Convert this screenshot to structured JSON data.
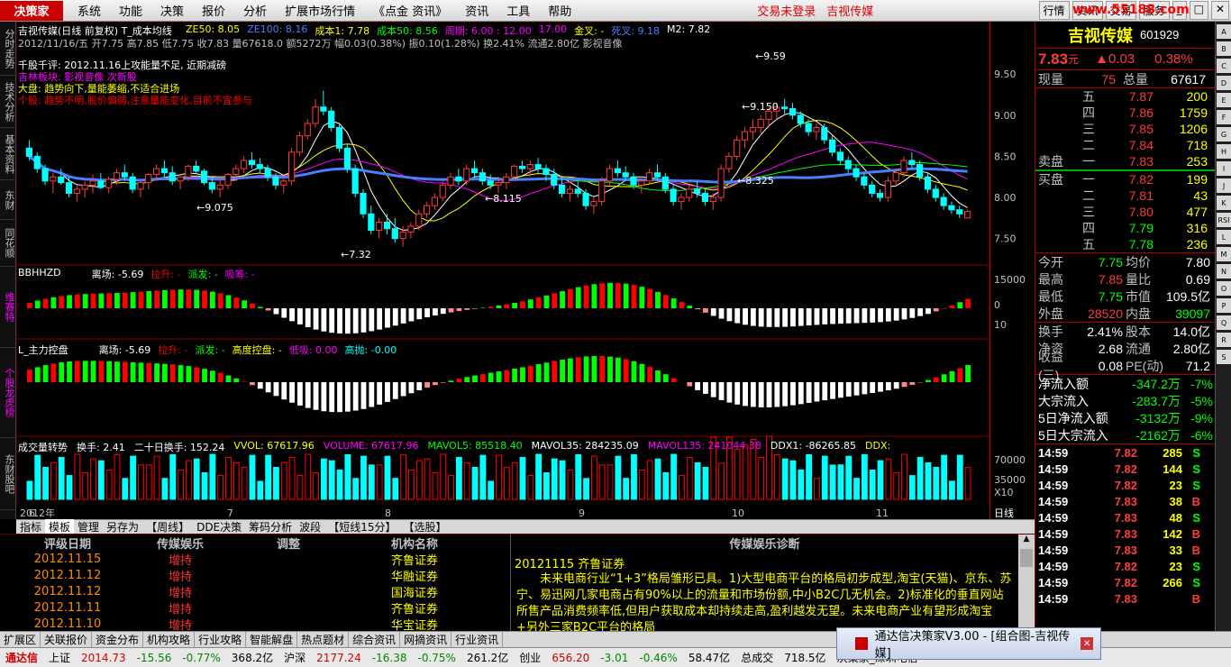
{
  "menubar": {
    "logo": "决策家",
    "items": [
      "系统",
      "功能",
      "决策",
      "报价",
      "分析",
      "扩展市场行情",
      "《点金 资讯》",
      "资讯",
      "工具",
      "帮助"
    ],
    "alerts": [
      "交易未登录",
      "吉视传媒"
    ],
    "right_buttons": [
      "行情",
      "资讯",
      "交易",
      "服务"
    ],
    "watermark": "www.55188.com"
  },
  "left_tabs": [
    "分时走势",
    "技术分析",
    "基本资料",
    "东财",
    "同花顺"
  ],
  "price_panel": {
    "title": "吉视传媒(日线 前复权) T_成本均线",
    "ma_labels": [
      {
        "t": "ZE50: 8.05",
        "c": "#ff0"
      },
      {
        "t": "ZE100: 8.16",
        "c": "#4a80ff"
      },
      {
        "t": "成本1: 7.78",
        "c": "#ff0"
      },
      {
        "t": "成本50: 8.56",
        "c": "#0f0"
      },
      {
        "t": "周期: 6.00 : 12.00",
        "c": "#f0f"
      },
      {
        "t": "17.00",
        "c": "#f0f"
      },
      {
        "t": "金叉: -",
        "c": "#ff0"
      },
      {
        "t": "死叉: 9.18",
        "c": "#4a80ff"
      },
      {
        "t": "M2: 7.82",
        "c": "#fff"
      }
    ],
    "info_line": "2012/11/16/五 开7.75 高7.85 低7.75 收7.83 量67618.0 额5272万 幅0.03(0.38%) 振0.10(1.28%) 换2.41% 流通2.80亿 影视音像",
    "comments": [
      {
        "t": "千股千评: 2012.11.16上攻能量不足, 近期减磅",
        "c": "#fff"
      },
      {
        "t": "吉林板块: 影视音像 次新股",
        "c": "#f0f"
      },
      {
        "t": "大盘: 趋势向下,量能萎缩,不适合进场",
        "c": "#ff0"
      },
      {
        "t": "个股: 趋势不明,股价偏弱,注意量能变化,目前不宜参与",
        "c": "#f00"
      }
    ],
    "annotations": [
      "9.075",
      "8.115",
      "8.325",
      "9.150",
      "9.59",
      "7.32"
    ],
    "y_ticks": [
      "9.50",
      "9.00",
      "8.50",
      "8.00",
      "7.50"
    ]
  },
  "ind1": {
    "name": "BBHHZD",
    "labels": [
      {
        "t": "离场: -5.69",
        "c": "#fff"
      },
      {
        "t": "拉升: -",
        "c": "#f00"
      },
      {
        "t": "派发: -",
        "c": "#0f0"
      },
      {
        "t": "吸筹: -",
        "c": "#f0f"
      }
    ],
    "y_ticks": [
      "15000",
      "0",
      "10"
    ],
    "side": "维赛特"
  },
  "ind2": {
    "name": "L_主力控盘",
    "labels": [
      {
        "t": "离场: -5.69",
        "c": "#fff"
      },
      {
        "t": "拉升: -",
        "c": "#f00"
      },
      {
        "t": "派发: -",
        "c": "#0f0"
      },
      {
        "t": "高度控盘: -",
        "c": "#ff0"
      },
      {
        "t": "低吸: 0.00",
        "c": "#f0f"
      },
      {
        "t": "高抛: -0.00",
        "c": "#0ff"
      }
    ],
    "side": "个股龙虎榜"
  },
  "ind3": {
    "name": "成交量转势",
    "labels": [
      {
        "t": "换手: 2.41",
        "c": "#fff"
      },
      {
        "t": "二十日换手: 152.24",
        "c": "#fff"
      },
      {
        "t": "VVOL: 67617.96",
        "c": "#ff0"
      },
      {
        "t": "VOLUME: 67617.96",
        "c": "#f0f"
      },
      {
        "t": "MAVOL5: 85518.40",
        "c": "#0f0"
      },
      {
        "t": "MAVOL35: 284235.09",
        "c": "#fff"
      },
      {
        "t": "MAVOL135: 241044.38",
        "c": "#f0f"
      },
      {
        "t": "DDX1: -86265.85",
        "c": "#fff"
      },
      {
        "t": "DDX:",
        "c": "#ff0"
      }
    ],
    "y_ticks": [
      "70000",
      "35000",
      "X10"
    ],
    "side": "东财股吧"
  },
  "date_axis": [
    "2012年",
    "6",
    "7",
    "8",
    "9",
    "10",
    "11"
  ],
  "date_axis_right": "日线",
  "bottom_tabs": [
    "指标",
    "模板",
    "管理",
    "另存为",
    "【周线】",
    "DDE决策",
    "筹码分析",
    "波段",
    "【短线15分】",
    "【选股】"
  ],
  "rating_table": {
    "headers": [
      "评级日期",
      "传媒娱乐",
      "调整",
      "机构名称"
    ],
    "rows": [
      [
        "2012.11.15",
        "增持",
        "",
        "齐鲁证券"
      ],
      [
        "2012.11.12",
        "增持",
        "",
        "华融证券"
      ],
      [
        "2012.11.12",
        "增持",
        "",
        "国海证券"
      ],
      [
        "2012.11.11",
        "增持",
        "",
        "齐鲁证券"
      ],
      [
        "2012.11.10",
        "增持",
        "",
        "华宝证券"
      ]
    ]
  },
  "diagnosis": {
    "title": "传媒娱乐诊断",
    "date_line": "20121115 齐鲁证券",
    "body": "未来电商行业“1+3”格局雏形已具。1)大型电商平台的格局初步成型,淘宝(天猫)、京东、苏宁、易迅网几家电商占有90%以上的流量和市场份额,中小B2C几无机会。2)标准化的垂直网站所售产品消费频率低,但用户获取成本却持续走高,盈利越发无望。未来电商产业有望形成淘宝+另外三家B2C平台的格局"
  },
  "quote": {
    "name": "吉视传媒",
    "code": "601929",
    "price": "7.83",
    "unit": "元",
    "change": "▲0.03",
    "pct": "0.38%",
    "now_vol_label": "现量",
    "now_vol": "75",
    "total_label": "总量",
    "total": "67617",
    "sells": [
      {
        "l": "五",
        "p": "7.87",
        "v": "200"
      },
      {
        "l": "四",
        "p": "7.86",
        "v": "1759"
      },
      {
        "l": "三",
        "p": "7.85",
        "v": "1206"
      },
      {
        "l": "二",
        "p": "7.84",
        "v": "718"
      },
      {
        "l": "一",
        "p": "7.83",
        "v": "253"
      }
    ],
    "sell_label": "卖盘",
    "buy_label": "买盘",
    "buys": [
      {
        "l": "一",
        "p": "7.82",
        "v": "199"
      },
      {
        "l": "二",
        "p": "7.81",
        "v": "43"
      },
      {
        "l": "三",
        "p": "7.80",
        "v": "477"
      },
      {
        "l": "四",
        "p": "7.79",
        "v": "316"
      },
      {
        "l": "五",
        "p": "7.78",
        "v": "236"
      }
    ],
    "stats": [
      [
        {
          "l": "今开",
          "v": "7.75",
          "c": "#0f0"
        },
        {
          "l": "均价",
          "v": "7.80",
          "c": "#fff"
        }
      ],
      [
        {
          "l": "最高",
          "v": "7.85",
          "c": "#ff3b3b"
        },
        {
          "l": "量比",
          "v": "0.69",
          "c": "#fff"
        }
      ],
      [
        {
          "l": "最低",
          "v": "7.75",
          "c": "#0f0"
        },
        {
          "l": "市值",
          "v": "109.5亿",
          "c": "#fff"
        }
      ],
      [
        {
          "l": "外盘",
          "v": "28520",
          "c": "#ff3b3b"
        },
        {
          "l": "内盘",
          "v": "39097",
          "c": "#0f0"
        }
      ]
    ],
    "stats2": [
      [
        {
          "l": "换手",
          "v": "2.41%",
          "c": "#fff"
        },
        {
          "l": "股本",
          "v": "14.0亿",
          "c": "#fff"
        }
      ],
      [
        {
          "l": "净资",
          "v": "2.68",
          "c": "#fff"
        },
        {
          "l": "流通",
          "v": "2.80亿",
          "c": "#fff"
        }
      ],
      [
        {
          "l": "收益(三)",
          "v": "0.08",
          "c": "#fff"
        },
        {
          "l": "PE(动)",
          "v": "71.2",
          "c": "#fff"
        }
      ]
    ],
    "flows": [
      {
        "l": "净流入额",
        "v": "-347.2万",
        "p": "-7%"
      },
      {
        "l": "大宗流入",
        "v": "-283.7万",
        "p": "-5%"
      },
      {
        "l": "5日净流入额",
        "v": "-3132万",
        "p": "-9%"
      },
      {
        "l": "5日大宗流入",
        "v": "-2162万",
        "p": "-6%"
      }
    ],
    "ticks": [
      [
        "14:59",
        "7.82",
        "285",
        "S"
      ],
      [
        "14:59",
        "7.82",
        "144",
        "S"
      ],
      [
        "14:59",
        "7.82",
        "23",
        "S"
      ],
      [
        "14:59",
        "7.83",
        "38",
        "B"
      ],
      [
        "14:59",
        "7.83",
        "48",
        "S"
      ],
      [
        "14:59",
        "7.83",
        "142",
        "B"
      ],
      [
        "14:59",
        "7.83",
        "33",
        "B"
      ],
      [
        "14:59",
        "7.82",
        "23",
        "S"
      ],
      [
        "14:59",
        "7.82",
        "266",
        "S"
      ],
      [
        "14:59",
        "7.83",
        "",
        "B"
      ]
    ]
  },
  "nav_tabs": [
    "扩展区",
    "关联报价",
    "资金分布",
    "机构攻略",
    "行业攻略",
    "智能解盘",
    "热点题材",
    "综合资讯",
    "网摘资讯",
    "行业资讯"
  ],
  "status": {
    "brand": "通达信",
    "items": [
      {
        "t": "上证",
        "c": "#000"
      },
      {
        "t": "2014.73",
        "c": "#c00"
      },
      {
        "t": "-15.56",
        "c": "#080"
      },
      {
        "t": "-0.77%",
        "c": "#080"
      },
      {
        "t": "368.2亿",
        "c": "#000"
      },
      {
        "t": "沪深",
        "c": "#000"
      },
      {
        "t": "2177.24",
        "c": "#c00"
      },
      {
        "t": "-16.38",
        "c": "#080"
      },
      {
        "t": "-0.75%",
        "c": "#080"
      },
      {
        "t": "261.2亿",
        "c": "#000"
      },
      {
        "t": "创业",
        "c": "#000"
      },
      {
        "t": "656.20",
        "c": "#c00"
      },
      {
        "t": "-3.01",
        "c": "#080"
      },
      {
        "t": "-0.46%",
        "c": "#080"
      },
      {
        "t": "58.47亿",
        "c": "#000"
      },
      {
        "t": "总成交",
        "c": "#000"
      },
      {
        "t": "718.5亿",
        "c": "#000"
      },
      {
        "t": "决策家_深圳电信",
        "c": "#000"
      }
    ]
  },
  "popup": {
    "text": "通达信决策家V3.00 - [组合图-吉视传媒]"
  },
  "right_tool_icons": [
    "A",
    "B",
    "C",
    "D",
    "E",
    "F",
    "G",
    "H",
    "I",
    "J",
    "K",
    "RSI",
    "L",
    "M",
    "N",
    "O",
    "P",
    "Q",
    "R",
    "S"
  ],
  "chart_data": {
    "type": "candlestick",
    "title": "吉视传媒(日线 前复权)",
    "ylim": [
      7.2,
      9.7
    ],
    "ohlc": [
      [
        8.6,
        8.7,
        8.45,
        8.5
      ],
      [
        8.5,
        8.55,
        8.3,
        8.35
      ],
      [
        8.35,
        8.4,
        8.15,
        8.2
      ],
      [
        8.2,
        8.3,
        8.05,
        8.25
      ],
      [
        8.25,
        8.35,
        8.15,
        8.18
      ],
      [
        8.18,
        8.25,
        8.0,
        8.05
      ],
      [
        8.05,
        8.15,
        7.95,
        8.1
      ],
      [
        8.1,
        8.2,
        8.0,
        8.15
      ],
      [
        8.15,
        8.28,
        8.05,
        8.2
      ],
      [
        8.2,
        8.3,
        8.1,
        8.12
      ],
      [
        8.12,
        8.25,
        8.05,
        8.22
      ],
      [
        8.22,
        8.35,
        8.15,
        8.3
      ],
      [
        8.3,
        8.4,
        8.2,
        8.25
      ],
      [
        8.25,
        8.3,
        8.05,
        8.1
      ],
      [
        8.1,
        8.2,
        8.0,
        8.18
      ],
      [
        8.18,
        8.3,
        8.1,
        8.28
      ],
      [
        8.28,
        8.4,
        8.2,
        8.35
      ],
      [
        8.35,
        8.45,
        8.25,
        8.3
      ],
      [
        8.3,
        8.38,
        8.15,
        8.2
      ],
      [
        8.2,
        8.28,
        8.1,
        8.25
      ],
      [
        8.25,
        8.4,
        8.2,
        8.38
      ],
      [
        8.38,
        8.45,
        8.3,
        8.32
      ],
      [
        8.32,
        8.35,
        8.15,
        8.18
      ],
      [
        8.18,
        8.25,
        8.05,
        8.1
      ],
      [
        8.1,
        8.2,
        8.0,
        8.15
      ],
      [
        8.15,
        8.3,
        8.1,
        8.28
      ],
      [
        8.28,
        8.4,
        8.2,
        8.35
      ],
      [
        8.35,
        8.5,
        8.3,
        8.45
      ],
      [
        8.45,
        8.55,
        8.35,
        8.4
      ],
      [
        8.4,
        8.48,
        8.3,
        8.35
      ],
      [
        8.35,
        8.4,
        8.2,
        8.25
      ],
      [
        8.25,
        8.3,
        8.1,
        8.15
      ],
      [
        8.15,
        8.25,
        8.05,
        8.2
      ],
      [
        8.2,
        8.6,
        8.15,
        8.55
      ],
      [
        8.55,
        8.8,
        8.5,
        8.75
      ],
      [
        8.75,
        8.95,
        8.7,
        8.9
      ],
      [
        8.9,
        9.2,
        8.85,
        9.1
      ],
      [
        9.1,
        9.3,
        9.0,
        9.05
      ],
      [
        9.05,
        9.1,
        8.8,
        8.85
      ],
      [
        8.85,
        8.9,
        8.55,
        8.6
      ],
      [
        8.6,
        8.65,
        8.3,
        8.35
      ],
      [
        8.35,
        8.4,
        8.0,
        8.05
      ],
      [
        8.05,
        8.1,
        7.75,
        7.8
      ],
      [
        7.8,
        7.9,
        7.55,
        7.6
      ],
      [
        7.6,
        7.75,
        7.5,
        7.7
      ],
      [
        7.7,
        7.8,
        7.55,
        7.62
      ],
      [
        7.62,
        7.75,
        7.45,
        7.5
      ],
      [
        7.5,
        7.65,
        7.4,
        7.58
      ],
      [
        7.58,
        7.7,
        7.5,
        7.65
      ],
      [
        7.65,
        7.85,
        7.6,
        7.8
      ],
      [
        7.8,
        7.95,
        7.75,
        7.9
      ],
      [
        7.9,
        8.05,
        7.85,
        8.0
      ],
      [
        8.0,
        8.2,
        7.95,
        8.15
      ],
      [
        8.15,
        8.3,
        8.1,
        8.25
      ],
      [
        8.25,
        8.35,
        8.15,
        8.2
      ],
      [
        8.2,
        8.4,
        8.15,
        8.35
      ],
      [
        8.35,
        8.45,
        8.25,
        8.3
      ],
      [
        8.3,
        8.35,
        8.15,
        8.2
      ],
      [
        8.2,
        8.28,
        8.1,
        8.15
      ],
      [
        8.15,
        8.25,
        8.05,
        8.18
      ],
      [
        8.18,
        8.3,
        8.1,
        8.25
      ],
      [
        8.25,
        8.4,
        8.2,
        8.38
      ],
      [
        8.38,
        8.45,
        8.3,
        8.35
      ],
      [
        8.35,
        8.45,
        8.25,
        8.4
      ],
      [
        8.4,
        8.48,
        8.3,
        8.35
      ],
      [
        8.35,
        8.4,
        8.2,
        8.28
      ],
      [
        8.28,
        8.35,
        8.1,
        8.15
      ],
      [
        8.15,
        8.25,
        8.0,
        8.05
      ],
      [
        8.05,
        8.15,
        7.95,
        8.1
      ],
      [
        8.1,
        8.2,
        8.0,
        8.05
      ],
      [
        8.05,
        8.1,
        7.85,
        7.9
      ],
      [
        7.9,
        8.0,
        7.8,
        7.95
      ],
      [
        7.95,
        8.25,
        7.9,
        8.2
      ],
      [
        8.2,
        8.4,
        8.15,
        8.35
      ],
      [
        8.35,
        8.45,
        8.25,
        8.3
      ],
      [
        8.3,
        8.38,
        8.2,
        8.25
      ],
      [
        8.25,
        8.3,
        8.1,
        8.15
      ],
      [
        8.15,
        8.25,
        8.05,
        8.2
      ],
      [
        8.2,
        8.35,
        8.15,
        8.3
      ],
      [
        8.3,
        8.4,
        8.2,
        8.25
      ],
      [
        8.25,
        8.3,
        8.05,
        8.1
      ],
      [
        8.1,
        8.15,
        7.9,
        7.95
      ],
      [
        7.95,
        8.05,
        7.85,
        8.0
      ],
      [
        8.0,
        8.15,
        7.95,
        8.1
      ],
      [
        8.1,
        8.2,
        8.0,
        8.05
      ],
      [
        8.05,
        8.1,
        7.9,
        7.95
      ],
      [
        7.95,
        8.05,
        7.85,
        8.0
      ],
      [
        8.0,
        8.4,
        7.95,
        8.35
      ],
      [
        8.35,
        8.55,
        8.3,
        8.5
      ],
      [
        8.5,
        8.75,
        8.45,
        8.7
      ],
      [
        8.7,
        8.85,
        8.6,
        8.8
      ],
      [
        8.8,
        8.95,
        8.7,
        8.85
      ],
      [
        8.85,
        9.0,
        8.75,
        8.95
      ],
      [
        8.95,
        9.1,
        8.85,
        9.05
      ],
      [
        9.05,
        9.15,
        8.95,
        9.1
      ],
      [
        9.1,
        9.2,
        9.0,
        9.08
      ],
      [
        9.08,
        9.15,
        8.95,
        9.0
      ],
      [
        9.0,
        9.05,
        8.85,
        8.9
      ],
      [
        8.9,
        8.95,
        8.75,
        8.8
      ],
      [
        8.8,
        8.9,
        8.7,
        8.85
      ],
      [
        8.85,
        8.9,
        8.65,
        8.7
      ],
      [
        8.7,
        8.75,
        8.5,
        8.55
      ],
      [
        8.55,
        8.6,
        8.4,
        8.45
      ],
      [
        8.45,
        8.5,
        8.3,
        8.35
      ],
      [
        8.35,
        8.4,
        8.2,
        8.25
      ],
      [
        8.25,
        8.3,
        8.1,
        8.15
      ],
      [
        8.15,
        8.2,
        8.0,
        8.05
      ],
      [
        8.05,
        8.1,
        7.95,
        8.0
      ],
      [
        8.0,
        8.25,
        7.95,
        8.2
      ],
      [
        8.2,
        8.35,
        8.15,
        8.3
      ],
      [
        8.3,
        8.5,
        8.25,
        8.45
      ],
      [
        8.45,
        8.55,
        8.35,
        8.4
      ],
      [
        8.4,
        8.45,
        8.2,
        8.25
      ],
      [
        8.25,
        8.3,
        8.05,
        8.1
      ],
      [
        8.1,
        8.15,
        7.95,
        8.0
      ],
      [
        8.0,
        8.05,
        7.85,
        7.9
      ],
      [
        7.9,
        7.95,
        7.8,
        7.85
      ],
      [
        7.85,
        7.9,
        7.75,
        7.8
      ],
      [
        7.75,
        7.85,
        7.75,
        7.83
      ]
    ]
  }
}
